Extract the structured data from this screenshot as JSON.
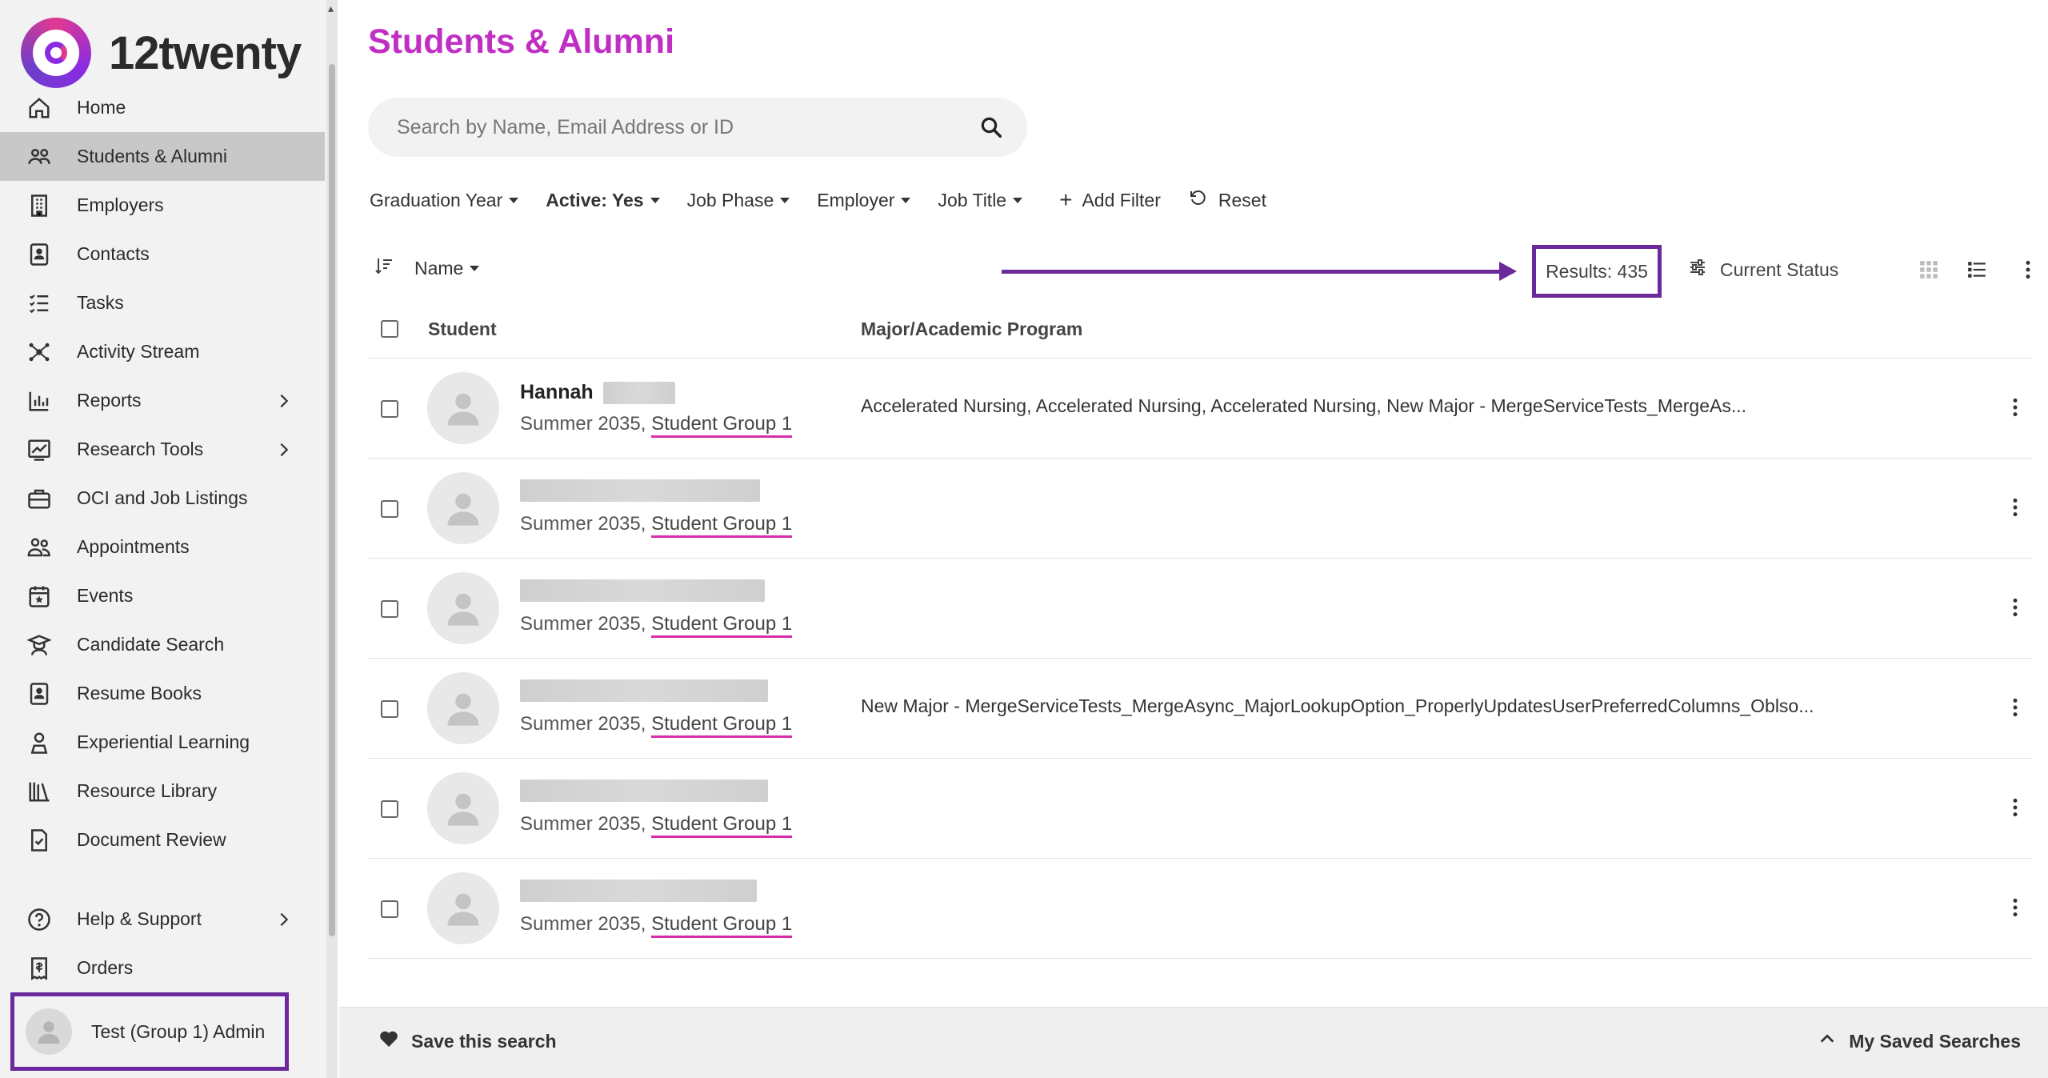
{
  "app": {
    "brand": "12twenty"
  },
  "sidebar": {
    "items": [
      {
        "label": "Home",
        "icon": "home-icon"
      },
      {
        "label": "Students & Alumni",
        "icon": "users-icon",
        "active": true
      },
      {
        "label": "Employers",
        "icon": "building-icon"
      },
      {
        "label": "Contacts",
        "icon": "contact-card-icon"
      },
      {
        "label": "Tasks",
        "icon": "checklist-icon"
      },
      {
        "label": "Activity Stream",
        "icon": "network-icon"
      },
      {
        "label": "Reports",
        "icon": "bar-chart-icon",
        "chevron": true
      },
      {
        "label": "Research Tools",
        "icon": "trend-chart-icon",
        "chevron": true
      },
      {
        "label": "OCI and Job Listings",
        "icon": "briefcase-icon"
      },
      {
        "label": "Appointments",
        "icon": "people-icon"
      },
      {
        "label": "Events",
        "icon": "calendar-star-icon"
      },
      {
        "label": "Candidate Search",
        "icon": "graduate-icon"
      },
      {
        "label": "Resume Books",
        "icon": "resume-icon"
      },
      {
        "label": "Experiential Learning",
        "icon": "person-pin-icon"
      },
      {
        "label": "Resource Library",
        "icon": "library-icon"
      },
      {
        "label": "Document Review",
        "icon": "document-check-icon"
      }
    ],
    "bottom_items": [
      {
        "label": "Help & Support",
        "icon": "help-icon",
        "chevron": true
      },
      {
        "label": "Orders",
        "icon": "receipt-icon"
      }
    ],
    "user": {
      "name": "Test (Group 1) Admin"
    }
  },
  "main": {
    "title": "Students & Alumni",
    "search": {
      "placeholder": "Search by Name, Email Address or ID",
      "value": ""
    },
    "filters": [
      {
        "label": "Graduation Year",
        "bold": false
      },
      {
        "label": "Active: Yes",
        "bold": true
      },
      {
        "label": "Job Phase",
        "bold": false
      },
      {
        "label": "Employer",
        "bold": false
      },
      {
        "label": "Job Title",
        "bold": false
      }
    ],
    "add_filter_label": "Add Filter",
    "reset_label": "Reset",
    "sort_label": "Name",
    "results_label": "Results: 435",
    "current_status_label": "Current Status",
    "columns": {
      "student": "Student",
      "major": "Major/Academic Program"
    },
    "rows": [
      {
        "first_name": "Hannah",
        "class": "Summer 2035,",
        "group": "Student Group 1",
        "major": "Accelerated Nursing, Accelerated Nursing, Accelerated Nursing, New Major - MergeServiceTests_MergeAs...",
        "blur": 90
      },
      {
        "first_name": "",
        "class": "Summer 2035,",
        "group": "Student Group 1",
        "major": "",
        "blur": 300
      },
      {
        "first_name": "",
        "class": "Summer 2035,",
        "group": "Student Group 1",
        "major": "",
        "blur": 306
      },
      {
        "first_name": "",
        "class": "Summer 2035,",
        "group": "Student Group 1",
        "major": "New Major - MergeServiceTests_MergeAsync_MajorLookupOption_ProperlyUpdatesUserPreferredColumns_Oblso...",
        "blur": 310
      },
      {
        "first_name": "",
        "class": "Summer 2035,",
        "group": "Student Group 1",
        "major": "",
        "blur": 310
      },
      {
        "first_name": "",
        "class": "Summer 2035,",
        "group": "Student Group 1",
        "major": "",
        "blur": 296
      }
    ],
    "footer": {
      "save_label": "Save this search",
      "saved_label": "My Saved Searches"
    }
  },
  "colors": {
    "title": "#c02ec4",
    "highlight": "#6b2a9c",
    "underline": "#d62ea8"
  }
}
